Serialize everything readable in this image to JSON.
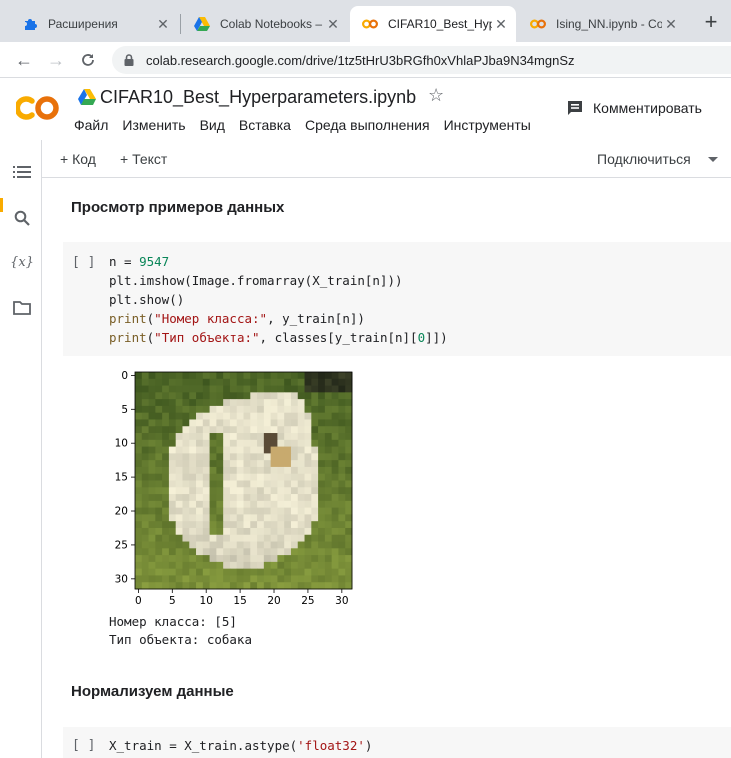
{
  "browser": {
    "tabs": [
      {
        "title": "Расширения",
        "active": false,
        "icon": "puzzle-icon"
      },
      {
        "title": "Colab Notebooks – ",
        "active": false,
        "icon": "drive-icon"
      },
      {
        "title": "CIFAR10_Best_Hype",
        "active": true,
        "icon": "colab-icon"
      },
      {
        "title": "Ising_NN.ipynb - Co",
        "active": false,
        "icon": "colab-icon"
      }
    ],
    "new_tab": "+",
    "url": "colab.research.google.com/drive/1tz5tHrU3bRGfh0xVhlaPJba9N34mgnSz"
  },
  "colab": {
    "logo": "CO",
    "title": "CIFAR10_Best_Hyperparameters.ipynb",
    "menu": [
      "Файл",
      "Изменить",
      "Вид",
      "Вставка",
      "Среда выполнения",
      "Инструменты"
    ],
    "comment": "Комментировать",
    "add_code": "+ Код",
    "add_text": "+ Текст",
    "connect": "Подключиться"
  },
  "notebook": {
    "heading1": "Просмотр примеров данных",
    "cell1": {
      "run": "[ ]",
      "lines": [
        "n = 9547",
        "plt.imshow(Image.fromarray(X_train[n]))",
        "plt.show()",
        "print(\"Номер класса:\", y_train[n])",
        "print(\"Тип объекта:\", classes[y_train[n][0]])"
      ]
    },
    "output1": [
      "Номер класса: [5]",
      "Тип объекта: собака"
    ],
    "heading2": "Нормализуем данные",
    "cell2": {
      "run": "[ ]",
      "lines": [
        "X_train = X_train.astype('float32')"
      ]
    }
  },
  "chart_data": {
    "type": "heatmap",
    "title": "",
    "xlabel": "",
    "ylabel": "",
    "x_ticks": [
      0,
      5,
      10,
      15,
      20,
      25,
      30
    ],
    "y_ticks": [
      0,
      5,
      10,
      15,
      20,
      25,
      30
    ],
    "xlim": [
      -0.5,
      31.5
    ],
    "ylim": [
      31.5,
      -0.5
    ],
    "image_size": [
      32,
      32
    ]
  }
}
